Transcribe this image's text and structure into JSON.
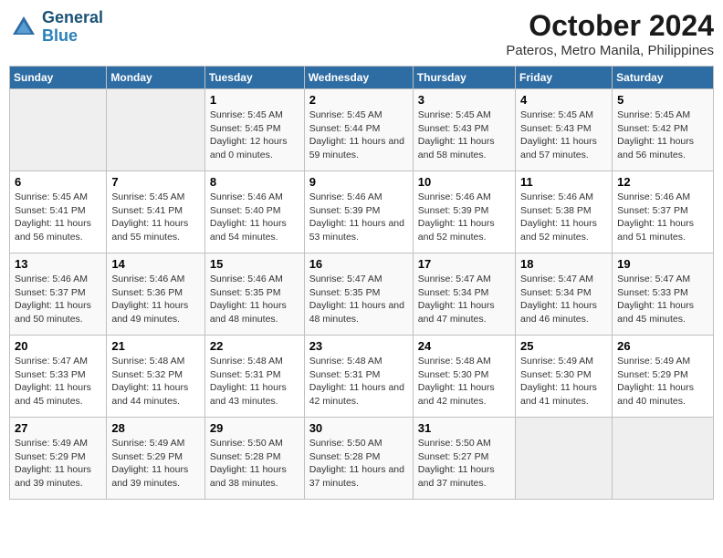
{
  "logo": {
    "line1": "General",
    "line2": "Blue"
  },
  "title": "October 2024",
  "subtitle": "Pateros, Metro Manila, Philippines",
  "headers": [
    "Sunday",
    "Monday",
    "Tuesday",
    "Wednesday",
    "Thursday",
    "Friday",
    "Saturday"
  ],
  "weeks": [
    [
      {
        "day": "",
        "sunrise": "",
        "sunset": "",
        "daylight": "",
        "empty": true
      },
      {
        "day": "",
        "sunrise": "",
        "sunset": "",
        "daylight": "",
        "empty": true
      },
      {
        "day": "1",
        "sunrise": "Sunrise: 5:45 AM",
        "sunset": "Sunset: 5:45 PM",
        "daylight": "Daylight: 12 hours and 0 minutes."
      },
      {
        "day": "2",
        "sunrise": "Sunrise: 5:45 AM",
        "sunset": "Sunset: 5:44 PM",
        "daylight": "Daylight: 11 hours and 59 minutes."
      },
      {
        "day": "3",
        "sunrise": "Sunrise: 5:45 AM",
        "sunset": "Sunset: 5:43 PM",
        "daylight": "Daylight: 11 hours and 58 minutes."
      },
      {
        "day": "4",
        "sunrise": "Sunrise: 5:45 AM",
        "sunset": "Sunset: 5:43 PM",
        "daylight": "Daylight: 11 hours and 57 minutes."
      },
      {
        "day": "5",
        "sunrise": "Sunrise: 5:45 AM",
        "sunset": "Sunset: 5:42 PM",
        "daylight": "Daylight: 11 hours and 56 minutes."
      }
    ],
    [
      {
        "day": "6",
        "sunrise": "Sunrise: 5:45 AM",
        "sunset": "Sunset: 5:41 PM",
        "daylight": "Daylight: 11 hours and 56 minutes."
      },
      {
        "day": "7",
        "sunrise": "Sunrise: 5:45 AM",
        "sunset": "Sunset: 5:41 PM",
        "daylight": "Daylight: 11 hours and 55 minutes."
      },
      {
        "day": "8",
        "sunrise": "Sunrise: 5:46 AM",
        "sunset": "Sunset: 5:40 PM",
        "daylight": "Daylight: 11 hours and 54 minutes."
      },
      {
        "day": "9",
        "sunrise": "Sunrise: 5:46 AM",
        "sunset": "Sunset: 5:39 PM",
        "daylight": "Daylight: 11 hours and 53 minutes."
      },
      {
        "day": "10",
        "sunrise": "Sunrise: 5:46 AM",
        "sunset": "Sunset: 5:39 PM",
        "daylight": "Daylight: 11 hours and 52 minutes."
      },
      {
        "day": "11",
        "sunrise": "Sunrise: 5:46 AM",
        "sunset": "Sunset: 5:38 PM",
        "daylight": "Daylight: 11 hours and 52 minutes."
      },
      {
        "day": "12",
        "sunrise": "Sunrise: 5:46 AM",
        "sunset": "Sunset: 5:37 PM",
        "daylight": "Daylight: 11 hours and 51 minutes."
      }
    ],
    [
      {
        "day": "13",
        "sunrise": "Sunrise: 5:46 AM",
        "sunset": "Sunset: 5:37 PM",
        "daylight": "Daylight: 11 hours and 50 minutes."
      },
      {
        "day": "14",
        "sunrise": "Sunrise: 5:46 AM",
        "sunset": "Sunset: 5:36 PM",
        "daylight": "Daylight: 11 hours and 49 minutes."
      },
      {
        "day": "15",
        "sunrise": "Sunrise: 5:46 AM",
        "sunset": "Sunset: 5:35 PM",
        "daylight": "Daylight: 11 hours and 48 minutes."
      },
      {
        "day": "16",
        "sunrise": "Sunrise: 5:47 AM",
        "sunset": "Sunset: 5:35 PM",
        "daylight": "Daylight: 11 hours and 48 minutes."
      },
      {
        "day": "17",
        "sunrise": "Sunrise: 5:47 AM",
        "sunset": "Sunset: 5:34 PM",
        "daylight": "Daylight: 11 hours and 47 minutes."
      },
      {
        "day": "18",
        "sunrise": "Sunrise: 5:47 AM",
        "sunset": "Sunset: 5:34 PM",
        "daylight": "Daylight: 11 hours and 46 minutes."
      },
      {
        "day": "19",
        "sunrise": "Sunrise: 5:47 AM",
        "sunset": "Sunset: 5:33 PM",
        "daylight": "Daylight: 11 hours and 45 minutes."
      }
    ],
    [
      {
        "day": "20",
        "sunrise": "Sunrise: 5:47 AM",
        "sunset": "Sunset: 5:33 PM",
        "daylight": "Daylight: 11 hours and 45 minutes."
      },
      {
        "day": "21",
        "sunrise": "Sunrise: 5:48 AM",
        "sunset": "Sunset: 5:32 PM",
        "daylight": "Daylight: 11 hours and 44 minutes."
      },
      {
        "day": "22",
        "sunrise": "Sunrise: 5:48 AM",
        "sunset": "Sunset: 5:31 PM",
        "daylight": "Daylight: 11 hours and 43 minutes."
      },
      {
        "day": "23",
        "sunrise": "Sunrise: 5:48 AM",
        "sunset": "Sunset: 5:31 PM",
        "daylight": "Daylight: 11 hours and 42 minutes."
      },
      {
        "day": "24",
        "sunrise": "Sunrise: 5:48 AM",
        "sunset": "Sunset: 5:30 PM",
        "daylight": "Daylight: 11 hours and 42 minutes."
      },
      {
        "day": "25",
        "sunrise": "Sunrise: 5:49 AM",
        "sunset": "Sunset: 5:30 PM",
        "daylight": "Daylight: 11 hours and 41 minutes."
      },
      {
        "day": "26",
        "sunrise": "Sunrise: 5:49 AM",
        "sunset": "Sunset: 5:29 PM",
        "daylight": "Daylight: 11 hours and 40 minutes."
      }
    ],
    [
      {
        "day": "27",
        "sunrise": "Sunrise: 5:49 AM",
        "sunset": "Sunset: 5:29 PM",
        "daylight": "Daylight: 11 hours and 39 minutes."
      },
      {
        "day": "28",
        "sunrise": "Sunrise: 5:49 AM",
        "sunset": "Sunset: 5:29 PM",
        "daylight": "Daylight: 11 hours and 39 minutes."
      },
      {
        "day": "29",
        "sunrise": "Sunrise: 5:50 AM",
        "sunset": "Sunset: 5:28 PM",
        "daylight": "Daylight: 11 hours and 38 minutes."
      },
      {
        "day": "30",
        "sunrise": "Sunrise: 5:50 AM",
        "sunset": "Sunset: 5:28 PM",
        "daylight": "Daylight: 11 hours and 37 minutes."
      },
      {
        "day": "31",
        "sunrise": "Sunrise: 5:50 AM",
        "sunset": "Sunset: 5:27 PM",
        "daylight": "Daylight: 11 hours and 37 minutes."
      },
      {
        "day": "",
        "sunrise": "",
        "sunset": "",
        "daylight": "",
        "empty": true
      },
      {
        "day": "",
        "sunrise": "",
        "sunset": "",
        "daylight": "",
        "empty": true
      }
    ]
  ]
}
